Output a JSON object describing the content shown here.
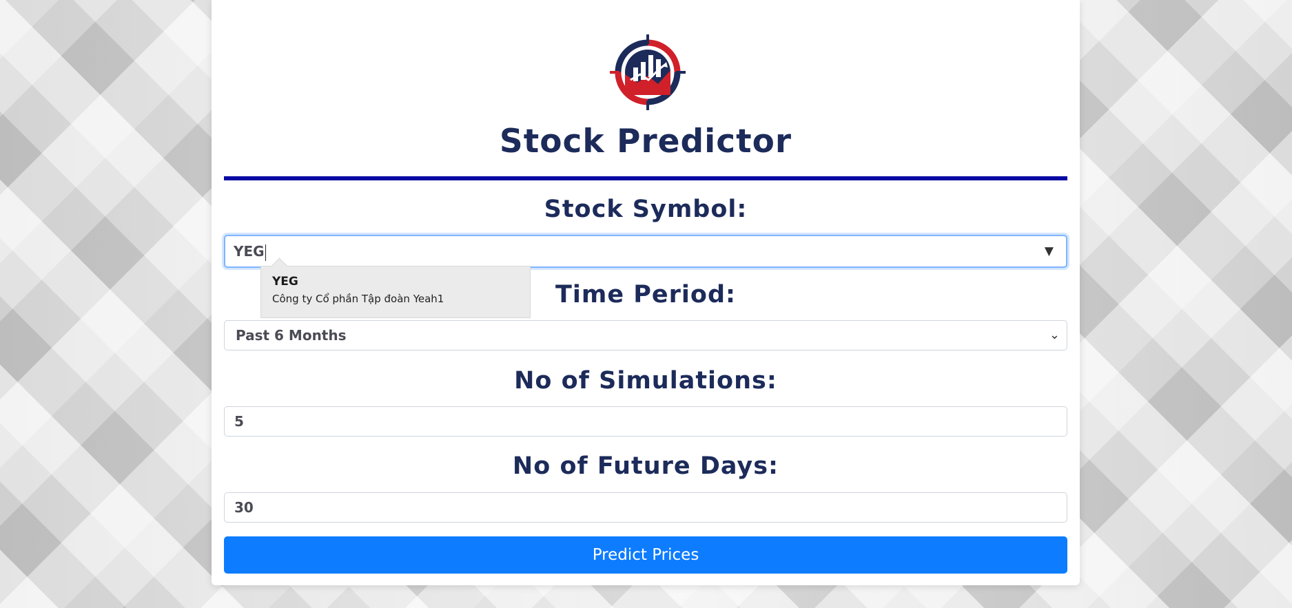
{
  "app": {
    "title": "Stock Predictor"
  },
  "form": {
    "symbol": {
      "label": "Stock Symbol:",
      "value": "YEG",
      "dropdown_icon": "triangle-down-icon"
    },
    "autocomplete": {
      "code": "YEG",
      "name": "Công ty Cổ phần Tập đoàn Yeah1"
    },
    "period": {
      "label": "Time Period:",
      "selected": "Past 6 Months"
    },
    "simulations": {
      "label": "No of Simulations:",
      "value": "5"
    },
    "future_days": {
      "label": "No of Future Days:",
      "value": "30"
    },
    "submit_label": "Predict Prices"
  },
  "colors": {
    "brand_navy": "#1c2b5a",
    "brand_red": "#d0202a",
    "rule": "#0a0aa3",
    "button": "#0d7cff"
  }
}
